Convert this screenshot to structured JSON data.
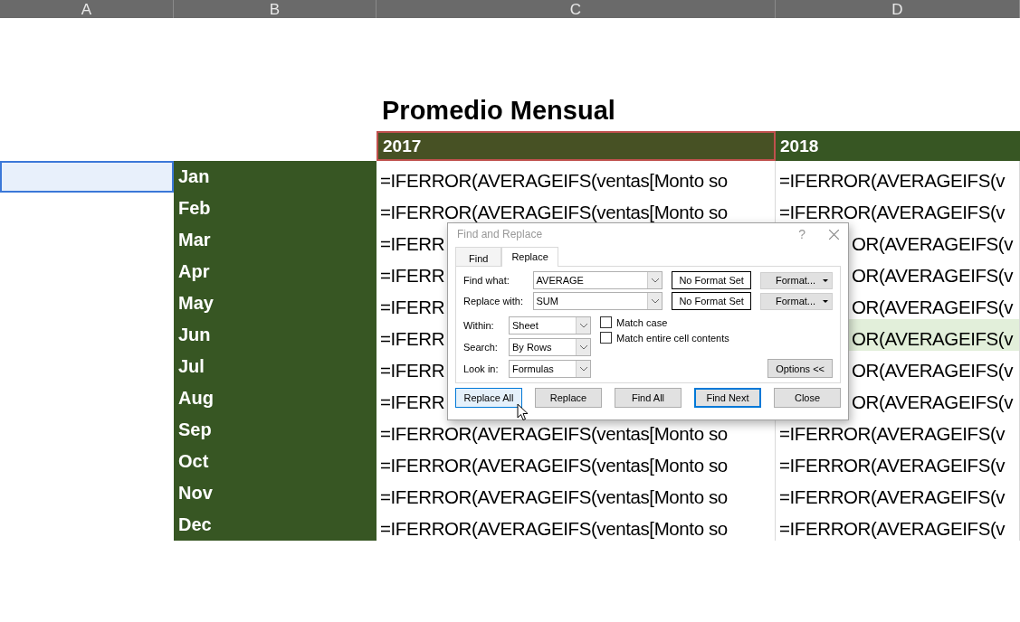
{
  "columns": [
    "A",
    "B",
    "C",
    "D"
  ],
  "title": "Promedio Mensual",
  "years": [
    {
      "text": "2017",
      "selected": true
    },
    {
      "text": "2018",
      "selected": false
    }
  ],
  "rows": [
    {
      "month": "Jan",
      "c": "=IFERROR(AVERAGEIFS(ventas[Monto so",
      "d": "=IFERROR(AVERAGEIFS(v",
      "covered": false,
      "selected": true,
      "highlighted": false
    },
    {
      "month": "Feb",
      "c": "=IFERROR(AVERAGEIFS(ventas[Monto so",
      "d": "=IFERROR(AVERAGEIFS(v",
      "covered": false,
      "selected": false,
      "highlighted": false
    },
    {
      "month": "Mar",
      "c": "=IFERR",
      "d": "OR(AVERAGEIFS(v",
      "covered": true,
      "selected": false,
      "highlighted": false
    },
    {
      "month": "Apr",
      "c": "=IFERR",
      "d": "OR(AVERAGEIFS(v",
      "covered": true,
      "selected": false,
      "highlighted": false
    },
    {
      "month": "May",
      "c": "=IFERR",
      "d": "OR(AVERAGEIFS(v",
      "covered": true,
      "selected": false,
      "highlighted": false
    },
    {
      "month": "Jun",
      "c": "=IFERR",
      "d": "OR(AVERAGEIFS(v",
      "covered": true,
      "selected": false,
      "highlighted": true
    },
    {
      "month": "Jul",
      "c": "=IFERR",
      "d": "OR(AVERAGEIFS(v",
      "covered": true,
      "selected": false,
      "highlighted": false
    },
    {
      "month": "Aug",
      "c": "=IFERR",
      "d": "OR(AVERAGEIFS(v",
      "covered": true,
      "selected": false,
      "highlighted": false
    },
    {
      "month": "Sep",
      "c": "=IFERROR(AVERAGEIFS(ventas[Monto so",
      "d": "=IFERROR(AVERAGEIFS(v",
      "covered": false,
      "selected": false,
      "highlighted": false
    },
    {
      "month": "Oct",
      "c": "=IFERROR(AVERAGEIFS(ventas[Monto so",
      "d": "=IFERROR(AVERAGEIFS(v",
      "covered": false,
      "selected": false,
      "highlighted": false
    },
    {
      "month": "Nov",
      "c": "=IFERROR(AVERAGEIFS(ventas[Monto so",
      "d": "=IFERROR(AVERAGEIFS(v",
      "covered": false,
      "selected": false,
      "highlighted": false
    },
    {
      "month": "Dec",
      "c": "=IFERROR(AVERAGEIFS(ventas[Monto so",
      "d": "=IFERROR(AVERAGEIFS(v",
      "covered": false,
      "selected": false,
      "highlighted": false
    }
  ],
  "dialog": {
    "title": "Find and Replace",
    "help": "?",
    "tabs": [
      {
        "label": "Find",
        "selected": false
      },
      {
        "label": "Replace",
        "selected": true
      }
    ],
    "fields": [
      {
        "label": "Find what:",
        "value": "AVERAGE",
        "format": "No Format Set",
        "format_button": "Format..."
      },
      {
        "label": "Replace with:",
        "value": "SUM",
        "format": "No Format Set",
        "format_button": "Format..."
      }
    ],
    "selects": [
      {
        "label": "Within:",
        "value": "Sheet"
      },
      {
        "label": "Search:",
        "value": "By Rows"
      },
      {
        "label": "Look in:",
        "value": "Formulas"
      }
    ],
    "checkboxes": [
      {
        "label": "Match case",
        "checked": false
      },
      {
        "label": "Match entire cell contents",
        "checked": false
      }
    ],
    "options_button": "Options <<",
    "buttons": [
      {
        "label": "Replace All",
        "kind": "hover"
      },
      {
        "label": "Replace",
        "kind": "normal"
      },
      {
        "label": "Find All",
        "kind": "normal"
      },
      {
        "label": "Find Next",
        "kind": "default"
      },
      {
        "label": "Close",
        "kind": "normal"
      }
    ]
  }
}
